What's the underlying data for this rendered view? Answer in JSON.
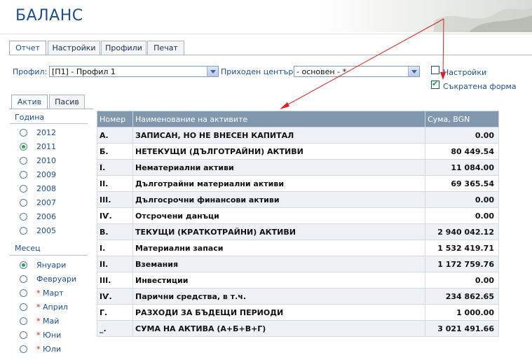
{
  "title": "БАЛАНС",
  "main_tabs": [
    {
      "label": "Отчет",
      "active": true
    },
    {
      "label": "Настройки",
      "active": false
    },
    {
      "label": "Профили",
      "active": false
    },
    {
      "label": "Печат",
      "active": false
    }
  ],
  "filters": {
    "profile_label": "Профил:",
    "profile_value": "[П1] - Профил 1",
    "center_label": "Приходен център:",
    "center_value": "- основен - *",
    "settings_checkbox": {
      "label": "Настройки",
      "checked": false
    },
    "short_form_checkbox": {
      "label": "Съкратена форма",
      "checked": true
    }
  },
  "side_tabs": [
    {
      "label": "Актив",
      "active": true
    },
    {
      "label": "Пасив",
      "active": false
    }
  ],
  "year_group": {
    "title": "Година",
    "options": [
      {
        "label": "2012",
        "selected": false
      },
      {
        "label": "2011",
        "selected": true
      },
      {
        "label": "2010",
        "selected": false
      },
      {
        "label": "2009",
        "selected": false
      },
      {
        "label": "2008",
        "selected": false
      },
      {
        "label": "2007",
        "selected": false
      },
      {
        "label": "2006",
        "selected": false
      },
      {
        "label": "2005",
        "selected": false
      }
    ]
  },
  "month_group": {
    "title": "Месец",
    "options": [
      {
        "label": "Януари",
        "selected": true,
        "star": false
      },
      {
        "label": "Февруари",
        "selected": false,
        "star": false
      },
      {
        "label": "Март",
        "selected": false,
        "star": true
      },
      {
        "label": "Април",
        "selected": false,
        "star": true
      },
      {
        "label": "Май",
        "selected": false,
        "star": true
      },
      {
        "label": "Юни",
        "selected": false,
        "star": true
      },
      {
        "label": "Юли",
        "selected": false,
        "star": true
      }
    ]
  },
  "table": {
    "headers": [
      "Номер",
      "Наименование на активите",
      "Сума, BGN"
    ],
    "rows": [
      [
        "А.",
        "ЗАПИСАН, НО НЕ ВНЕСЕН КАПИТАЛ",
        "0.00"
      ],
      [
        "Б.",
        "НЕТЕКУЩИ (ДЪЛГОТРАЙНИ) АКТИВИ",
        "80 449.54"
      ],
      [
        "І.",
        "Нематериални активи",
        "11 084.00"
      ],
      [
        "ІІ.",
        "Дълготрайни материални активи",
        "69 365.54"
      ],
      [
        "ІІІ.",
        "Дългосрочни финансови активи",
        "0.00"
      ],
      [
        "ІѴ.",
        "Отсрочени данъци",
        "0.00"
      ],
      [
        "В.",
        "ТЕКУЩИ (КРАТКОТРАЙНИ) АКТИВИ",
        "2 940 042.12"
      ],
      [
        "І.",
        "Материални запаси",
        "1 532 419.71"
      ],
      [
        "ІІ.",
        "Вземания",
        "1 172 759.76"
      ],
      [
        "ІІІ.",
        "Инвестиции",
        "0.00"
      ],
      [
        "ІѴ.",
        "Парични средства, в т.ч.",
        "234 862.65"
      ],
      [
        "Г.",
        "РАЗХОДИ ЗА БЪДЕЩИ ПЕРИОДИ",
        "1 000.00"
      ],
      [
        "_.",
        "СУМА НА АКТИВА (А+Б+В+Г)",
        "3 021 491.66"
      ]
    ]
  },
  "colors": {
    "accent": "#1d4f91",
    "header_bg": "#8197ae",
    "annotation_arrow": "#e02020"
  }
}
